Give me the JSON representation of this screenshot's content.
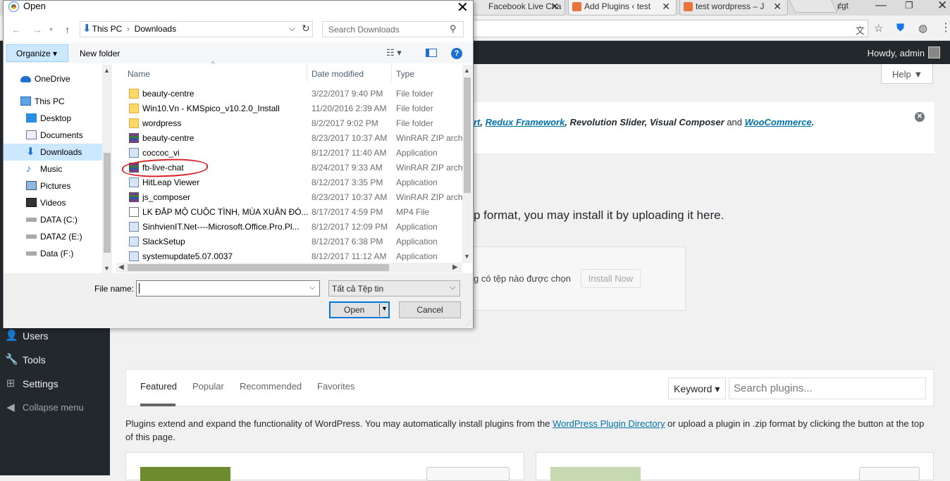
{
  "browser": {
    "tabs": [
      {
        "label": "Facebook Live Cha"
      },
      {
        "label": "Add Plugins ‹ test"
      },
      {
        "label": "test wordpress – J"
      }
    ],
    "colors": {
      "tab_icon": "#e8743b",
      "brand_blue": "#0073aa"
    }
  },
  "wp": {
    "admin_bar": {
      "howdy": "Howdy, admin"
    },
    "help_label": "Help ▼",
    "notice": {
      "prefix": "rt",
      "link1": "Redux Framework",
      "middle": ", Revolution Slider, Visual Composer",
      "and": " and ",
      "link2": "WooCommerce",
      "suffix": "."
    },
    "upload_help": "p format, you may install it by uploading it here.",
    "no_file": "g có tệp nào được chọn",
    "install_now": "Install Now",
    "sidebar": [
      {
        "label": "Users",
        "icon": "users-icon"
      },
      {
        "label": "Tools",
        "icon": "tools-icon"
      },
      {
        "label": "Settings",
        "icon": "settings-icon"
      },
      {
        "label": "Collapse menu",
        "icon": "collapse-icon"
      }
    ],
    "filter_tabs": [
      "Featured",
      "Popular",
      "Recommended",
      "Favorites"
    ],
    "keyword_select": "Keyword ▾",
    "search_placeholder": "Search plugins...",
    "desc_before": "Plugins extend and expand the functionality of WordPress. You may automatically install plugins from the ",
    "desc_link": "WordPress Plugin Directory",
    "desc_after": " or upload a plugin in .zip format by clicking the button at the top of this page."
  },
  "dialog": {
    "title": "Open",
    "path": [
      "This PC",
      "Downloads"
    ],
    "search_placeholder": "Search Downloads",
    "organize": "Organize ▾",
    "new_folder": "New folder",
    "nav_items": [
      {
        "label": "OneDrive"
      },
      {
        "label": "This PC"
      },
      {
        "label": "Desktop"
      },
      {
        "label": "Documents"
      },
      {
        "label": "Downloads",
        "selected": true
      },
      {
        "label": "Music"
      },
      {
        "label": "Pictures"
      },
      {
        "label": "Videos"
      },
      {
        "label": "DATA (C:)"
      },
      {
        "label": "DATA2 (E:)"
      },
      {
        "label": "Data (F:)"
      }
    ],
    "columns": {
      "name": "Name",
      "date": "Date modified",
      "type": "Type"
    },
    "files": [
      {
        "name": "beauty-centre",
        "date": "3/22/2017 9:40 PM",
        "type": "File folder",
        "icon": "folder"
      },
      {
        "name": "Win10.Vn - KMSpico_v10.2.0_Install",
        "date": "11/20/2016 2:39 AM",
        "type": "File folder",
        "icon": "folder"
      },
      {
        "name": "wordpress",
        "date": "8/2/2017 9:02 PM",
        "type": "File folder",
        "icon": "folder"
      },
      {
        "name": "beauty-centre",
        "date": "8/23/2017 10:37 AM",
        "type": "WinRAR ZIP archi",
        "icon": "zip"
      },
      {
        "name": "coccoc_vi",
        "date": "8/12/2017 11:40 AM",
        "type": "Application",
        "icon": "app"
      },
      {
        "name": "fb-live-chat",
        "date": "8/24/2017 9:33 AM",
        "type": "WinRAR ZIP archi",
        "icon": "zip"
      },
      {
        "name": "HitLeap Viewer",
        "date": "8/12/2017 3:35 PM",
        "type": "Application",
        "icon": "app"
      },
      {
        "name": "js_composer",
        "date": "8/23/2017 10:37 AM",
        "type": "WinRAR ZIP archi",
        "icon": "zip"
      },
      {
        "name": "LK ĐẮP MỘ CUỘC TÌNH, MÙA XUÂN ĐÓ...",
        "date": "8/17/2017 4:59 PM",
        "type": "MP4 File",
        "icon": "mp4"
      },
      {
        "name": "SinhvienIT.Net----Microsoft.Office.Pro.Pl...",
        "date": "8/12/2017 12:09 PM",
        "type": "Application",
        "icon": "app"
      },
      {
        "name": "SlackSetup",
        "date": "8/12/2017 6:38 PM",
        "type": "Application",
        "icon": "app"
      },
      {
        "name": "systemupdate5.07.0037",
        "date": "8/12/2017 11:12 AM",
        "type": "Application",
        "icon": "app"
      }
    ],
    "file_name_label": "File name:",
    "file_name_value": "",
    "file_type": "Tất cả Tệp tin",
    "open_label": "Open",
    "cancel_label": "Cancel"
  }
}
